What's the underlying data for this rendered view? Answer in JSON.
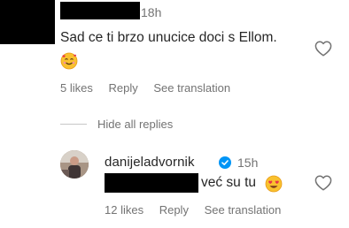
{
  "comment1": {
    "time": "18h",
    "text": "Sad ce ti brzo unucice doci s Ellom.",
    "emoji": "smiling-face-with-hearts",
    "likes": "5 likes",
    "reply": "Reply",
    "translate": "See translation"
  },
  "thread": {
    "hide_label": "Hide all replies"
  },
  "reply1": {
    "username": "danijeladvornik",
    "time": "15h",
    "text": "već su tu",
    "emoji": "heart-eyes-face",
    "likes": "12 likes",
    "reply": "Reply",
    "translate": "See translation"
  },
  "colors": {
    "verified": "#0095f6",
    "muted_text": "#737373",
    "text": "#262626"
  }
}
